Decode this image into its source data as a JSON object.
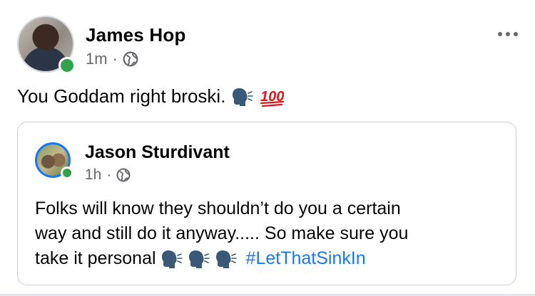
{
  "post": {
    "author": "James Hop",
    "time": "1m",
    "separator": "·",
    "privacy_icon": "globe-icon",
    "text": "You Goddam right broski.",
    "emojis": [
      "speaking-head-icon",
      "hundred-points-icon"
    ],
    "online": true
  },
  "shared_post": {
    "author": "Jason Sturdivant",
    "time": "1h",
    "separator": "·",
    "privacy_icon": "globe-icon",
    "lines": [
      "Folks will know they shouldn’t do you a certain",
      "way and still do it anyway..... So make sure you",
      "take it personal"
    ],
    "emojis": [
      "speaking-head-icon",
      "speaking-head-icon",
      "speaking-head-icon"
    ],
    "hashtag": "#LetThatSinkIn",
    "online": true
  },
  "colors": {
    "online": "#31a24c",
    "link": "#1877f2",
    "secondary_text": "#65676b",
    "hundred_red": "#e0161b"
  }
}
